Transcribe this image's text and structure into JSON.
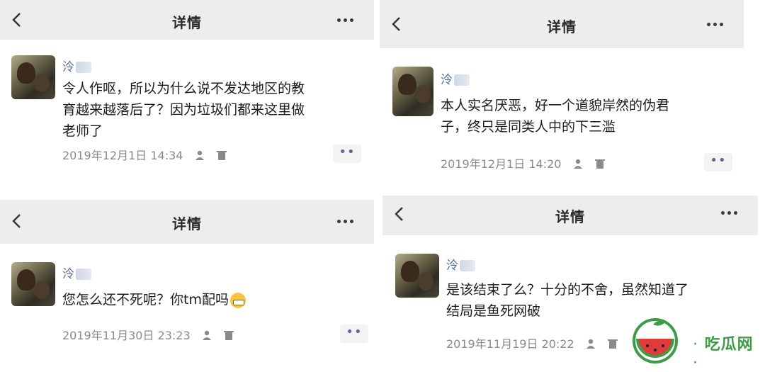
{
  "panels": [
    {
      "title": "详情",
      "author": "泠",
      "text": "令人作呕，所以为什么说不发达地区的教\n育越来越落后了？因为垃圾们都来这里做\n老师了",
      "timestamp": "2019年12月1日 14:34",
      "comment_icon": "comment-dots-icon"
    },
    {
      "title": "详情",
      "author": "泠",
      "text": "本人实名厌恶，好一个道貌岸然的伪君\n子，终只是同类人中的下三滥",
      "timestamp": "2019年12月1日 14:20",
      "comment_icon": "comment-dots-icon"
    },
    {
      "title": "详情",
      "author": "泠",
      "text": "您怎么还不死呢？你tm配吗",
      "timestamp": "2019年11月30日 23:23",
      "comment_icon": "comment-dots-icon"
    },
    {
      "title": "详情",
      "author": "泠",
      "text": "是该结束了么？十分的不舍，虽然知道了\n结局是鱼死网破",
      "timestamp": "2019年11月19日 20:22",
      "comment_icon": "comment-dots-icon"
    }
  ],
  "watermark": {
    "text": "吃瓜网",
    "dot_left": "·",
    "dot_right": "·"
  },
  "colors": {
    "header_bg": "#ededed",
    "name": "#576b95",
    "meta": "#8a8a8a",
    "brand": "#3f9b48"
  }
}
